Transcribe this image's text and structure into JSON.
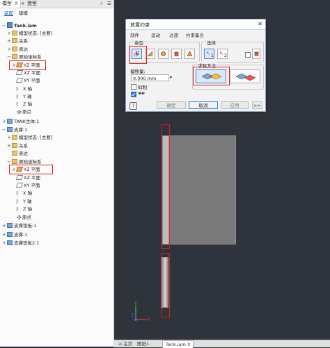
{
  "browser": {
    "tabs": {
      "model": "模型",
      "close": "X",
      "add": "+",
      "build": "造型"
    },
    "subtabs": {
      "assemble": "装配",
      "sep": "|",
      "model": "建模"
    },
    "tree": [
      {
        "label": "Tank.iam",
        "icon": "assembly"
      },
      {
        "label": "模型状态: [主要]",
        "icon": "folder"
      },
      {
        "label": "关系",
        "icon": "folder"
      },
      {
        "label": "表达",
        "icon": "folder"
      },
      {
        "label": "原始坐标系",
        "icon": "folder"
      },
      {
        "label": "YZ 平面",
        "icon": "plane"
      },
      {
        "label": "XZ 平面",
        "icon": "plane-gray"
      },
      {
        "label": "XY 平面",
        "icon": "plane-gray"
      },
      {
        "label": "X 轴",
        "icon": "axis"
      },
      {
        "label": "Y 轴",
        "icon": "axis"
      },
      {
        "label": "Z 轴",
        "icon": "axis"
      },
      {
        "label": "原点",
        "icon": "origin"
      },
      {
        "label": "TANK主体:1",
        "icon": "part"
      },
      {
        "label": "支撑:1",
        "icon": "part"
      },
      {
        "label": "模型状态: [主要]",
        "icon": "folder"
      },
      {
        "label": "关系",
        "icon": "folder"
      },
      {
        "label": "表达",
        "icon": "folder"
      },
      {
        "label": "原始坐标系",
        "icon": "folder"
      },
      {
        "label": "YZ 平面",
        "icon": "plane"
      },
      {
        "label": "XZ 平面",
        "icon": "plane-gray"
      },
      {
        "label": "XY 平面",
        "icon": "plane-gray"
      },
      {
        "label": "X 轴",
        "icon": "axis"
      },
      {
        "label": "Y 轴",
        "icon": "axis"
      },
      {
        "label": "Z 轴",
        "icon": "axis"
      },
      {
        "label": "原点",
        "icon": "origin"
      },
      {
        "label": "支撑垫板:1",
        "icon": "part"
      },
      {
        "label": "支撑:1",
        "icon": "part"
      },
      {
        "label": "支撑垫板2:1",
        "icon": "part"
      }
    ]
  },
  "dialog": {
    "title": "放置约束",
    "close": "✕",
    "tabs": [
      "部件",
      "运动",
      "过渡",
      "约束集合"
    ],
    "type_label": "类型",
    "select_label": "选择",
    "select_1": "1",
    "select_2": "2",
    "offset_label": "偏移量:",
    "offset_value": "0.000 mm",
    "solution_label": "求解方法",
    "predict_label": "抑制",
    "buttons": {
      "help": "?",
      "ok": "确定",
      "cancel": "取消",
      "apply": "应用",
      "more": ">>"
    }
  },
  "statusbar": {
    "home": "主页",
    "draw": "图纸1",
    "tank": "Tank.iam",
    "close": "X"
  },
  "triad": {
    "y": "Y",
    "x": "X",
    "z": "Z"
  },
  "colors": {
    "highlight": "#e21d1d",
    "viewport_bg": "#2f333b",
    "accent": "#3f7fcf"
  }
}
